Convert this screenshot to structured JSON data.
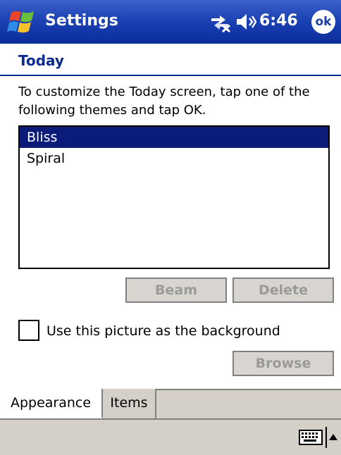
{
  "title_bar": {
    "app_title": "Settings",
    "clock": "6:46",
    "ok_label": "ok",
    "icons": [
      "windows-start-icon",
      "connectivity-icon",
      "volume-icon"
    ]
  },
  "page": {
    "title": "Today",
    "instructions": "To customize the Today screen, tap one of the following themes and tap OK."
  },
  "theme_list": {
    "items": [
      {
        "label": "Bliss",
        "selected": true
      },
      {
        "label": "Spiral",
        "selected": false
      }
    ]
  },
  "buttons": {
    "beam": "Beam",
    "delete": "Delete",
    "browse": "Browse"
  },
  "background_option": {
    "label": "Use this picture as the background",
    "checked": false
  },
  "tabs": [
    {
      "label": "Appearance",
      "active": true
    },
    {
      "label": "Items",
      "active": false
    }
  ],
  "command_bar": {
    "icons": [
      "keyboard-icon",
      "sip-arrow-up-icon"
    ]
  },
  "colors": {
    "title_bar": "#1c42b4",
    "heading": "#0d2b8d",
    "selection": "#0a1b7a",
    "chrome": "#d4d0c8"
  }
}
